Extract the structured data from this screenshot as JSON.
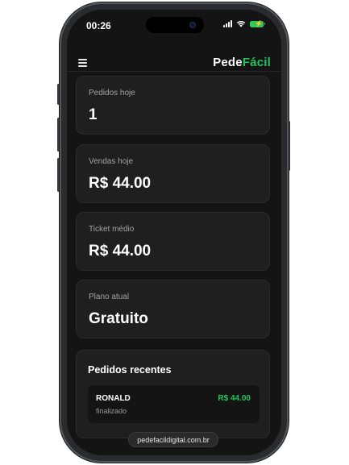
{
  "status_bar": {
    "time": "00:26"
  },
  "header": {
    "brand_main": "Pede",
    "brand_accent": "Fácil",
    "accent_color": "#22c55e"
  },
  "stats": [
    {
      "label": "Pedidos hoje",
      "value": "1"
    },
    {
      "label": "Vendas hoje",
      "value": "R$ 44.00"
    },
    {
      "label": "Ticket médio",
      "value": "R$ 44.00"
    },
    {
      "label": "Plano atual",
      "value": "Gratuito"
    }
  ],
  "recent_orders": {
    "title": "Pedidos recentes",
    "items": [
      {
        "customer": "RONALD",
        "status": "finalizado",
        "total": "R$ 44.00"
      }
    ]
  },
  "browser": {
    "url": "pedefacildigital.com.br"
  },
  "icons": {
    "menu": "hamburger-menu-icon",
    "signal": "cellular-signal-icon",
    "wifi": "wifi-icon",
    "battery": "battery-charging-icon"
  }
}
